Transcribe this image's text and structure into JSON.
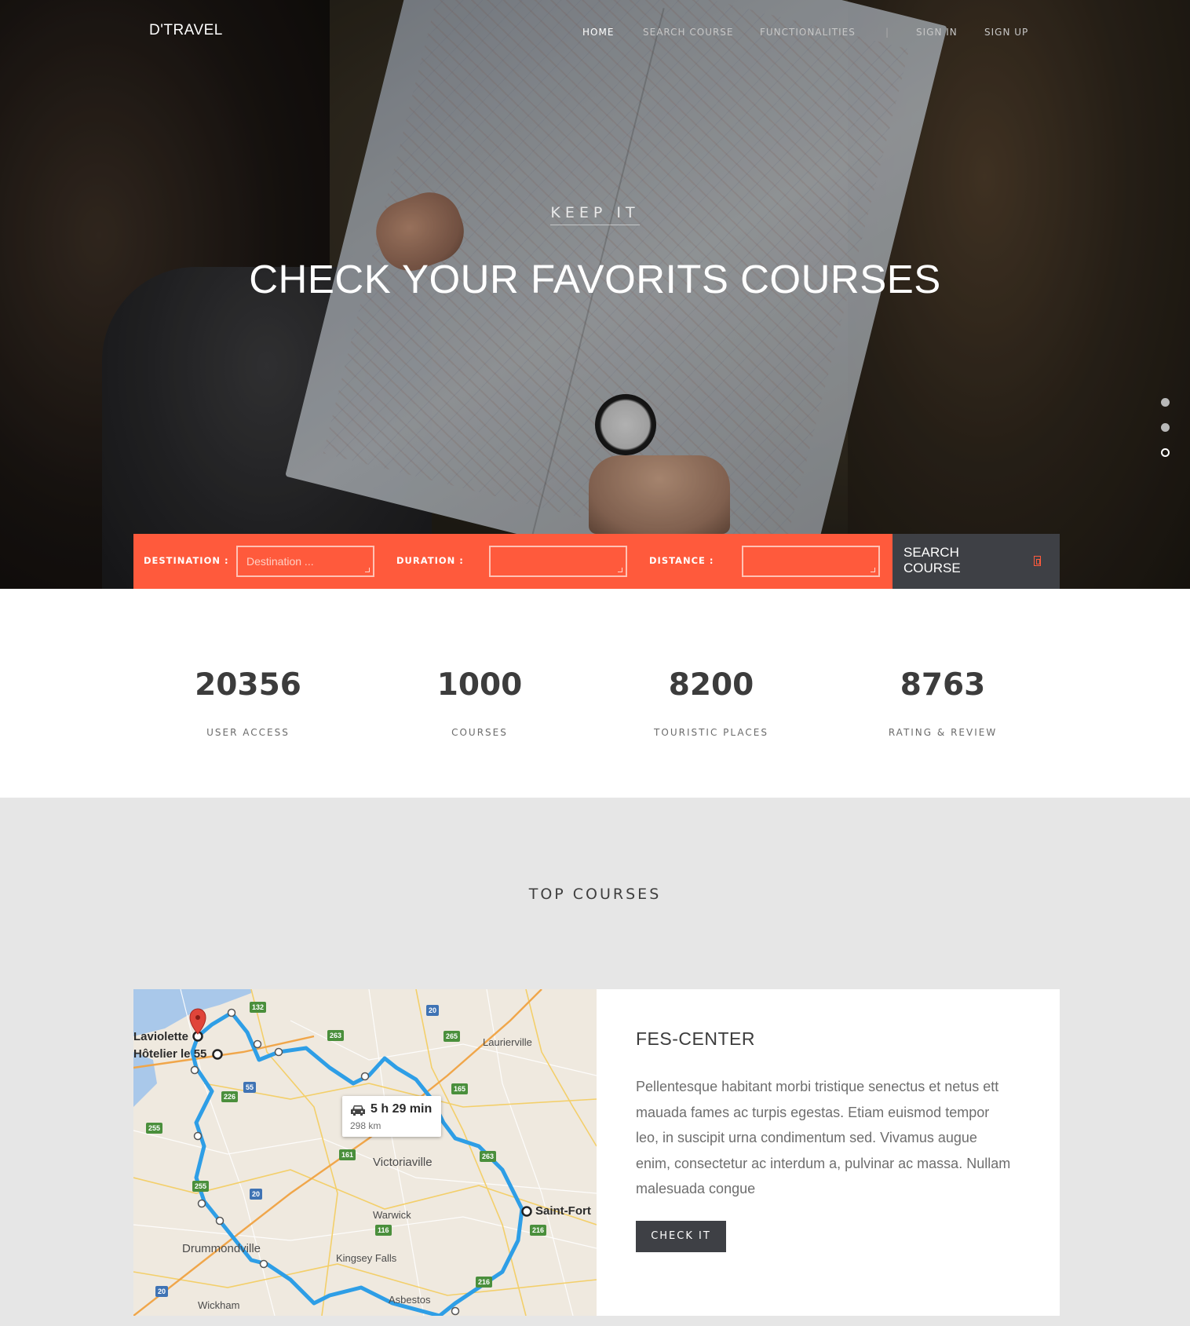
{
  "brand": "D'TRAVEL",
  "nav": {
    "home": "HOME",
    "search_course": "SEARCH COURSE",
    "functionalities": "FUNCTIONALITIES",
    "separator": "|",
    "sign_in": "SIGN IN",
    "sign_up": "SIGN UP"
  },
  "hero": {
    "eyebrow": "KEEP IT",
    "headline": "CHECK YOUR FAVORITS COURSES",
    "slider_active_index": 3,
    "slider_count": 3
  },
  "search": {
    "destination_label": "DESTINATION :",
    "destination_placeholder": "Destination ...",
    "duration_label": "DURATION :",
    "distance_label": "DISTANCE :",
    "button_label": "SEARCH COURSE"
  },
  "stats": [
    {
      "value": "20356",
      "label": "USER ACCESS"
    },
    {
      "value": "1000",
      "label": "COURSES"
    },
    {
      "value": "8200",
      "label": "TOURISTIC PLACES"
    },
    {
      "value": "8763",
      "label": "RATING & REVIEW"
    }
  ],
  "top_courses": {
    "title": "TOP COURSES",
    "course": {
      "title": "FES-CENTER",
      "description": "Pellentesque habitant morbi tristique senectus et netus ett mauada fames ac turpis egestas. Etiam euismod tempor leo, in suscipit urna condimentum sed. Vivamus augue enim, consectetur ac interdum a, pulvinar ac massa. Nullam malesuada congue",
      "button": "CHECK IT",
      "map": {
        "duration": "5 h 29 min",
        "distance": "298 km",
        "places": [
          "Laviolette",
          "Hôtelier le 55",
          "Laurierville",
          "Victoriaville",
          "Warwick",
          "Drummondville",
          "Kingsey Falls",
          "Saint-Fort",
          "Asbestos",
          "Wickham"
        ],
        "routes": [
          "132",
          "20",
          "263",
          "265",
          "55",
          "165",
          "226",
          "255",
          "161",
          "263",
          "255",
          "20",
          "116",
          "216",
          "216",
          "20"
        ]
      }
    }
  },
  "colors": {
    "accent": "#ff5a3c",
    "dark_button": "#3e4045",
    "route": "#2e9ee6"
  }
}
